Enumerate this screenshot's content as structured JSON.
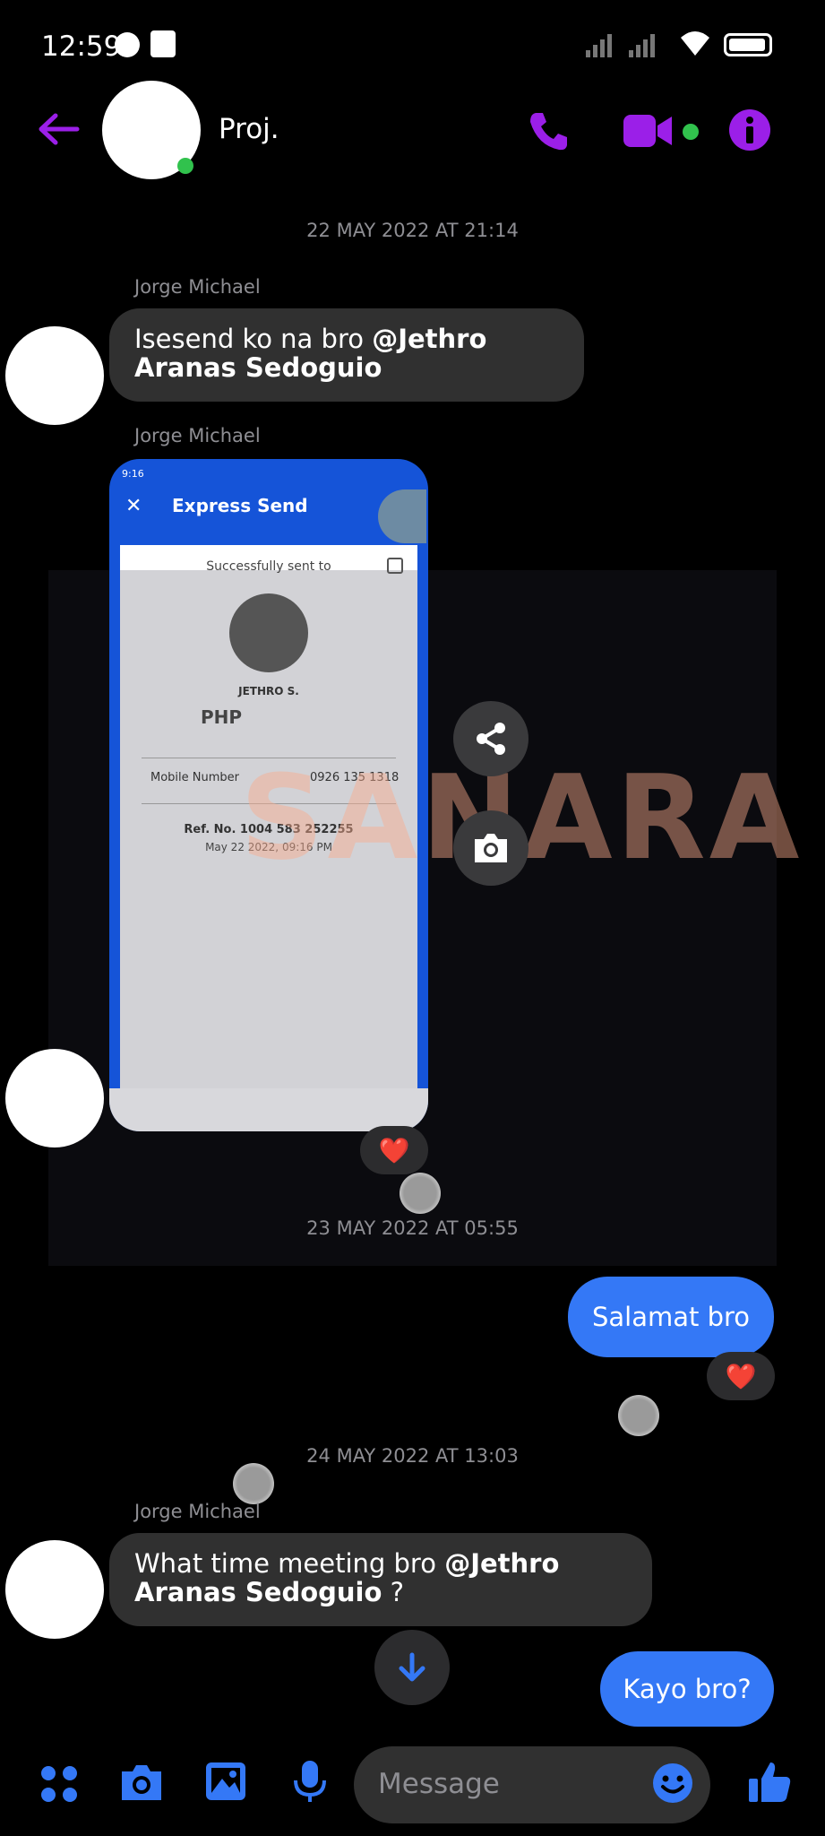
{
  "status_bar": {
    "time": "12:59"
  },
  "header": {
    "title": "Proj."
  },
  "colors": {
    "accent": "#9b1fe8",
    "bubble_out": "#3478f6",
    "bubble_in": "#303030",
    "online": "#31c24d"
  },
  "timestamps": [
    "22 MAY 2022 AT 21:14",
    "23 MAY 2022 AT 05:55",
    "24 MAY 2022 AT 13:03"
  ],
  "messages": [
    {
      "sender": "Jorge Michael",
      "text": "Isesend ko na bro ",
      "mention": "@Jethro Aranas Sedoguio",
      "suffix": ""
    },
    {
      "sender": "Jorge Michael",
      "type": "image"
    },
    {
      "text": "Salamat bro",
      "reaction": "❤️"
    },
    {
      "sender": "Jorge Michael",
      "text": "What time meeting bro ",
      "mention": "@Jethro Aranas Sedoguio",
      "suffix": " ?"
    },
    {
      "text": "Kayo bro?"
    }
  ],
  "image_reaction": "❤️",
  "screenshot": {
    "time": "9:16",
    "app_title": "Express Send",
    "sent_to": "Successfully sent to",
    "recipient": "JETHRO S.",
    "currency": "PHP",
    "field_label": "Mobile Number",
    "field_value": "0926 135 1318",
    "ref": "Ref. No. 1004 583 252255",
    "date": "May 22 2022, 09:16 PM",
    "watermark": "SANARA"
  },
  "composer": {
    "placeholder": "Message"
  },
  "icons": [
    "back-arrow-icon",
    "phone-icon",
    "video-icon",
    "info-icon",
    "apps-icon",
    "camera-icon",
    "gallery-icon",
    "mic-icon",
    "emoji-icon",
    "like-icon",
    "share-icon",
    "scroll-down-icon"
  ]
}
